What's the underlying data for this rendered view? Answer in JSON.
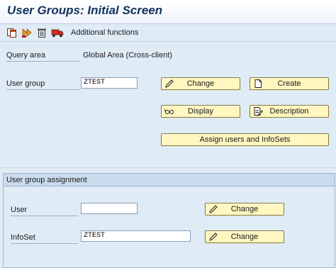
{
  "window": {
    "title": "User Groups: Initial Screen"
  },
  "toolbar": {
    "icons": [
      "copy-icon",
      "execute-icon",
      "delete-icon",
      "transport-icon"
    ],
    "additional_functions": "Additional functions"
  },
  "query_area": {
    "label": "Query area",
    "value": "Global Area (Cross-client)"
  },
  "user_group": {
    "label": "User group",
    "value": "ZTEST"
  },
  "buttons": {
    "change": "Change",
    "create": "Create",
    "display": "Display",
    "description": "Description",
    "assign": "Assign users and InfoSets"
  },
  "assignment": {
    "title": "User group assignment",
    "user_label": "User",
    "user_value": "",
    "infoset_label": "InfoSet",
    "infoset_value": "ZTEST",
    "user_change": "Change",
    "infoset_change": "Change"
  },
  "colors": {
    "background": "#dfebf5",
    "button": "#fff6c0",
    "title": "#13325e"
  }
}
